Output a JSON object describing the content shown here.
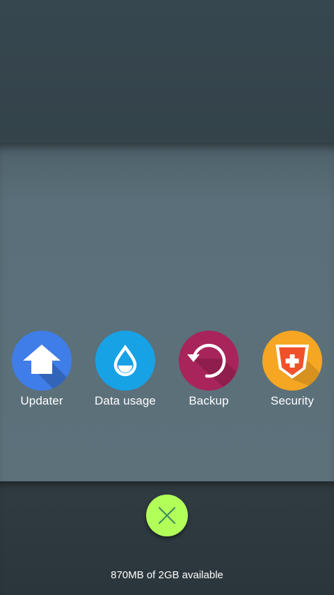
{
  "apps": [
    {
      "label": "Updater",
      "icon": "house-arrow-icon",
      "color": "#3f7de8"
    },
    {
      "label": "Data usage",
      "icon": "water-drop-icon",
      "color": "#17a2e6"
    },
    {
      "label": "Backup",
      "icon": "circular-arrow-icon",
      "color": "#a8245a"
    },
    {
      "label": "Security",
      "icon": "shield-icon",
      "color": "#f5a623"
    }
  ],
  "close_button": {
    "icon": "close-icon",
    "color": "#b2ff59"
  },
  "storage": {
    "text": "870MB of 2GB available"
  }
}
